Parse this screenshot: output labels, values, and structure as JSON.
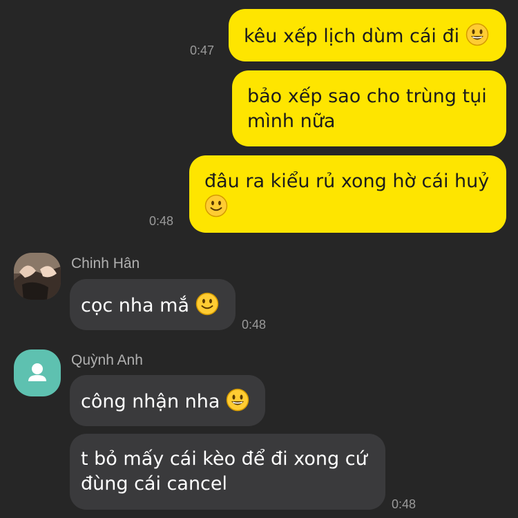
{
  "messages": [
    {
      "sender": "me",
      "text": "kêu xếp lịch dùm cái đi",
      "emoji": "grinning-face-icon",
      "time": "0:47"
    },
    {
      "sender": "me",
      "line1": "bảo xếp sao cho trùng tụi",
      "line2": "mình nữa"
    },
    {
      "sender": "me",
      "text": "đâu ra kiểu rủ xong hờ cái huỷ",
      "emoji": "slightly-smiling-face-icon",
      "time": "0:48"
    },
    {
      "sender": "Chinh Hân",
      "text": "cọc nha mắ",
      "emoji": "slightly-smiling-face-icon",
      "time": "0:48"
    },
    {
      "sender": "Quỳnh Anh",
      "text": "công nhận nha",
      "emoji": "grinning-face-icon"
    },
    {
      "sender": "Quỳnh Anh",
      "line1": "t bỏ mấy cái kèo để đi xong cứ",
      "line2": "đùng cái cancel",
      "time": "0:48"
    }
  ],
  "participants": {
    "chinh_han": {
      "name": "Chinh Hân",
      "avatar": "photo-avatar"
    },
    "quynh_anh": {
      "name": "Quỳnh Anh",
      "avatar": "default-person-icon"
    }
  },
  "colors": {
    "background": "#262626",
    "my_bubble": "#fee500",
    "their_bubble": "#3a3a3c",
    "default_avatar": "#5ec1b0"
  }
}
